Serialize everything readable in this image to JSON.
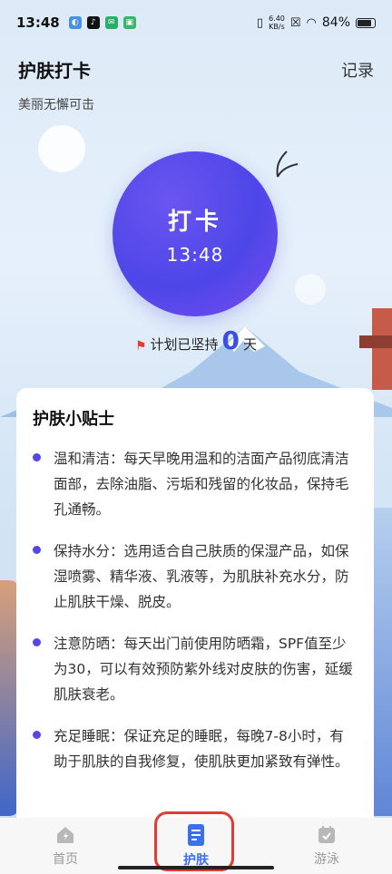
{
  "status": {
    "time": "13:48",
    "net_speed_top": "6.40",
    "net_speed_bottom": "KB/s",
    "battery": "84%"
  },
  "header": {
    "title": "护肤打卡",
    "record_label": "记录",
    "subtitle": "美丽无懈可击"
  },
  "checkin": {
    "label": "打卡",
    "time": "13:48"
  },
  "streak": {
    "prefix": "计划已坚持",
    "days": "0",
    "suffix": "天"
  },
  "tips": {
    "title": "护肤小贴士",
    "items": [
      "温和清洁：每天早晚用温和的洁面产品彻底清洁面部，去除油脂、污垢和残留的化妆品，保持毛孔通畅。",
      "保持水分：选用适合自己肤质的保湿产品，如保湿喷雾、精华液、乳液等，为肌肤补充水分，防止肌肤干燥、脱皮。",
      "注意防晒：每天出门前使用防晒霜，SPF值至少为30，可以有效预防紫外线对皮肤的伤害，延缓肌肤衰老。",
      "充足睡眠：保证充足的睡眠，每晚7-8小时，有助于肌肤的自我修复，使肌肤更加紧致有弹性。"
    ]
  },
  "tabbar": {
    "items": [
      {
        "label": "首页",
        "icon": "home-icon"
      },
      {
        "label": "护肤",
        "icon": "document-icon"
      },
      {
        "label": "游泳",
        "icon": "calendar-icon"
      }
    ],
    "active": "护肤"
  },
  "colors": {
    "accent": "#3b6ff0",
    "circle": "#4e46e8",
    "highlight": "#e53935"
  }
}
